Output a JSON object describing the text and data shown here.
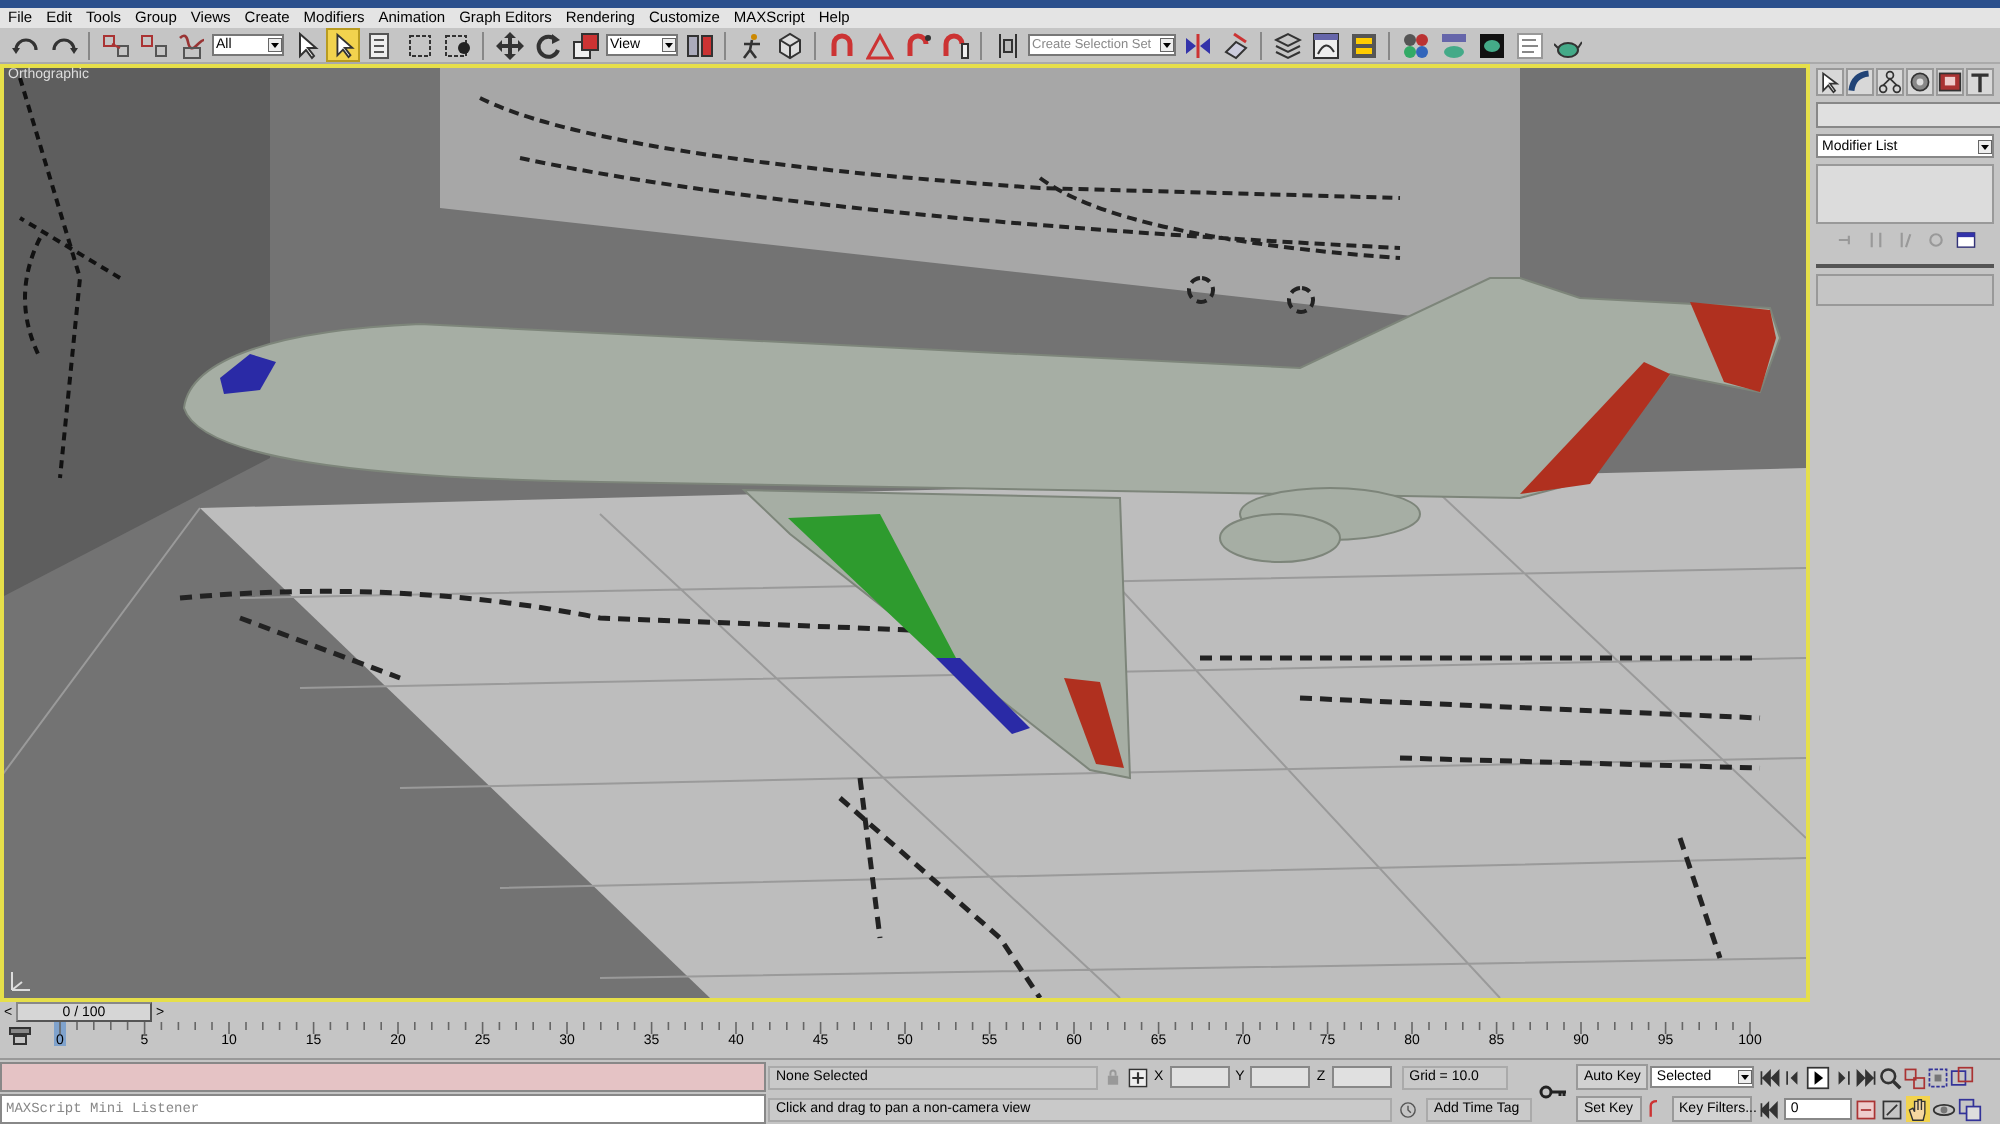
{
  "menu_bar": [
    "File",
    "Edit",
    "Tools",
    "Group",
    "Views",
    "Create",
    "Modifiers",
    "Animation",
    "Graph Editors",
    "Rendering",
    "Customize",
    "MAXScript",
    "Help"
  ],
  "toolbar": {
    "items": [
      {
        "kind": "button",
        "selected": false
      },
      {
        "kind": "button",
        "selected": false
      },
      {
        "kind": "separator"
      },
      {
        "kind": "button",
        "selected": false
      },
      {
        "kind": "button",
        "selected": false
      },
      {
        "kind": "button",
        "selected": false
      },
      {
        "kind": "dropdown",
        "value": "All"
      },
      {
        "kind": "button",
        "selected": false
      },
      {
        "kind": "button",
        "selected": true
      },
      {
        "kind": "button",
        "selected": false
      },
      {
        "kind": "button",
        "selected": false
      },
      {
        "kind": "button",
        "selected": false
      },
      {
        "kind": "separator"
      },
      {
        "kind": "button",
        "selected": false
      },
      {
        "kind": "button",
        "selected": false
      },
      {
        "kind": "button",
        "selected": false
      },
      {
        "kind": "dropdown",
        "value": "View"
      },
      {
        "kind": "button",
        "selected": false
      },
      {
        "kind": "separator"
      },
      {
        "kind": "button",
        "selected": false
      },
      {
        "kind": "button",
        "selected": false
      },
      {
        "kind": "separator"
      },
      {
        "kind": "button",
        "selected": false
      },
      {
        "kind": "button",
        "selected": false
      },
      {
        "kind": "button",
        "selected": false
      },
      {
        "kind": "button",
        "selected": false
      },
      {
        "kind": "separator"
      },
      {
        "kind": "button",
        "selected": false
      },
      {
        "kind": "dropdown",
        "placeholder": "Create Selection Set"
      },
      {
        "kind": "button",
        "selected": false
      },
      {
        "kind": "button",
        "selected": false
      },
      {
        "kind": "separator"
      },
      {
        "kind": "button",
        "selected": false
      },
      {
        "kind": "button",
        "selected": false
      },
      {
        "kind": "button",
        "selected": false
      },
      {
        "kind": "separator"
      },
      {
        "kind": "button",
        "selected": false
      },
      {
        "kind": "button",
        "selected": false
      },
      {
        "kind": "button",
        "selected": false
      },
      {
        "kind": "button",
        "selected": false
      },
      {
        "kind": "button",
        "selected": false
      }
    ]
  },
  "viewport": {
    "label": "Orthographic",
    "active": true
  },
  "command_panel": {
    "modifier_list": "Modifier List"
  },
  "time_slider": {
    "prev": "<",
    "frame": "0 / 100",
    "next": ">"
  },
  "track_bar": {
    "ticks": [
      "0",
      "5",
      "10",
      "15",
      "20",
      "25",
      "30",
      "35",
      "40",
      "45",
      "50",
      "55",
      "60",
      "65",
      "70",
      "75",
      "80",
      "85",
      "90",
      "95",
      "100"
    ]
  },
  "listener": {
    "placeholder": "MAXScript Mini Listener"
  },
  "status_bar": {
    "selection": "None Selected",
    "prompt": "Click and drag to pan a non-camera view",
    "x_label": "X",
    "y_label": "Y",
    "z_label": "Z",
    "grid": "Grid = 10.0",
    "time_tag": "Add Time Tag"
  },
  "animation_keys": {
    "auto_key": "Auto Key",
    "key_set": "Selected",
    "set_key": "Set Key",
    "key_filters": "Key Filters...",
    "frame": "0"
  },
  "nav_tools": [
    {
      "selected": false
    },
    {
      "selected": false
    },
    {
      "selected": false
    },
    {
      "selected": false
    },
    {
      "selected": false
    },
    {
      "selected": false
    },
    {
      "selected": false
    },
    {
      "selected": false
    },
    {
      "selected": false
    },
    {
      "selected": false
    },
    {
      "selected": false
    },
    {
      "selected": false
    },
    {
      "selected": true
    },
    {
      "selected": false
    },
    {
      "selected": false
    }
  ]
}
